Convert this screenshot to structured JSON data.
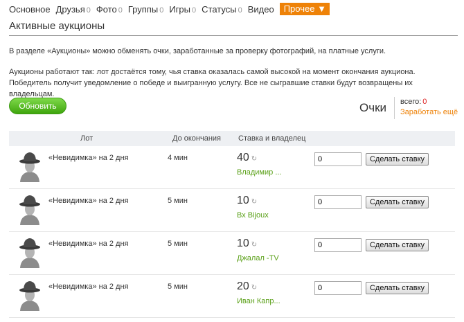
{
  "nav": {
    "items": [
      {
        "label": "Основное",
        "count": ""
      },
      {
        "label": "Друзья",
        "count": "0"
      },
      {
        "label": "Фото",
        "count": "0"
      },
      {
        "label": "Группы",
        "count": "0"
      },
      {
        "label": "Игры",
        "count": "0"
      },
      {
        "label": "Статусы",
        "count": "0"
      },
      {
        "label": "Видео",
        "count": ""
      }
    ],
    "more_label": "Прочее",
    "more_icon": "▼"
  },
  "page": {
    "title": "Активные аукционы",
    "intro_1": "В разделе «Аукционы» можно обменять очки, заработанные за проверку фотографий, на платные услуги.",
    "intro_2": "Аукционы работают так: лот достаётся тому, чья ставка оказалась самой высокой на момент окончания аукциона. Победитель получит уведомление о победе и выигранную услугу. Все не сыгравшие ставки будут возвращены их владельцам.",
    "refresh_label": "Обновить"
  },
  "points": {
    "title": "Очки",
    "total_label": "всего:",
    "total_value": "0",
    "earn_label": "Заработать ещё"
  },
  "table": {
    "headers": {
      "lot": "Лот",
      "ends": "До окончания",
      "bid": "Ставка и владелец"
    },
    "rows": [
      {
        "lot": "«Невидимка» на 2 дня",
        "ends": "4 мин",
        "bid": "40",
        "owner": "Владимир ...",
        "input": "0",
        "button": "Сделать ставку"
      },
      {
        "lot": "«Невидимка» на 2 дня",
        "ends": "5 мин",
        "bid": "10",
        "owner": "Вх Bijoux",
        "input": "0",
        "button": "Сделать ставку"
      },
      {
        "lot": "«Невидимка» на 2 дня",
        "ends": "5 мин",
        "bid": "10",
        "owner": "Джалал -TV",
        "input": "0",
        "button": "Сделать ставку"
      },
      {
        "lot": "«Невидимка» на 2 дня",
        "ends": "5 мин",
        "bid": "20",
        "owner": "Иван Капр...",
        "input": "0",
        "button": "Сделать ставку"
      }
    ]
  },
  "icons": {
    "refresh_bid": "↻",
    "avatar": "incognito-hat-icon"
  },
  "colors": {
    "accent": "#ee8208",
    "green": "#5aa018",
    "red": "#d22222"
  }
}
